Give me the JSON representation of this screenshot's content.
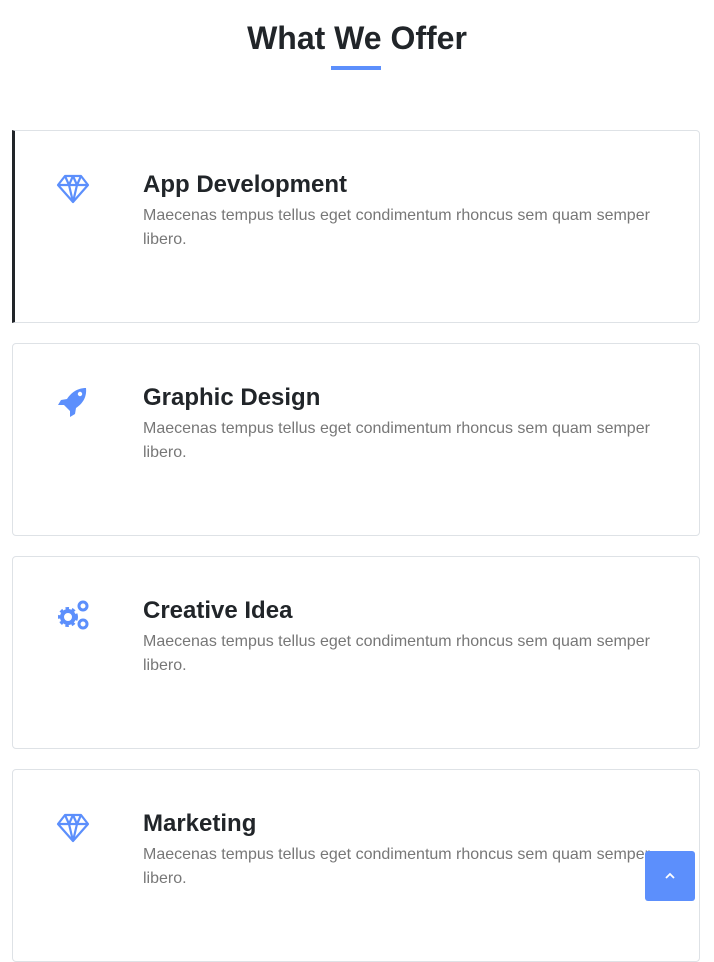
{
  "section": {
    "title": "What We Offer",
    "accent": "#5c8ffc"
  },
  "services": [
    {
      "icon": "diamond-icon",
      "title": "App Development",
      "description": "Maecenas tempus tellus eget condimentum rhoncus sem quam semper libero."
    },
    {
      "icon": "rocket-icon",
      "title": "Graphic Design",
      "description": "Maecenas tempus tellus eget condimentum rhoncus sem quam semper libero."
    },
    {
      "icon": "gears-icon",
      "title": "Creative Idea",
      "description": "Maecenas tempus tellus eget condimentum rhoncus sem quam semper libero."
    },
    {
      "icon": "diamond-icon",
      "title": "Marketing",
      "description": "Maecenas tempus tellus eget condimentum rhoncus sem quam semper libero."
    }
  ],
  "scroll_top": {
    "icon": "chevron-up-icon"
  }
}
